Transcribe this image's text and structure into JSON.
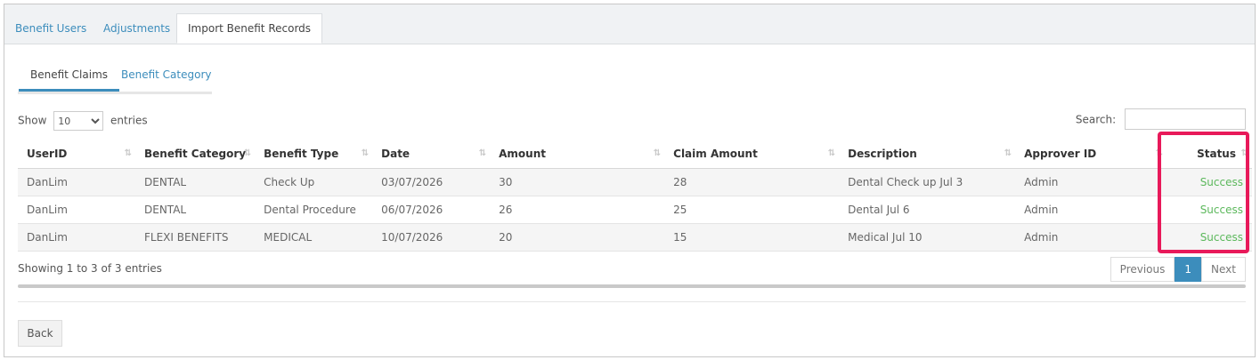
{
  "tabs": [
    {
      "label": "Benefit Users"
    },
    {
      "label": "Adjustments"
    },
    {
      "label": "Import Benefit Records"
    }
  ],
  "subtabs": [
    {
      "label": "Benefit Claims"
    },
    {
      "label": "Benefit Category"
    }
  ],
  "length": {
    "show": "Show",
    "value": "10",
    "entries": "entries"
  },
  "search": {
    "label": "Search:",
    "value": ""
  },
  "table": {
    "headers": [
      "UserID",
      "Benefit Category",
      "Benefit Type",
      "Date",
      "Amount",
      "Claim Amount",
      "Description",
      "Approver ID",
      "Status"
    ],
    "rows": [
      [
        "DanLim",
        "DENTAL",
        "Check Up",
        "03/07/2026",
        "30",
        "28",
        "Dental Check up Jul 3",
        "Admin",
        "Success"
      ],
      [
        "DanLim",
        "DENTAL",
        "Dental Procedure",
        "06/07/2026",
        "26",
        "25",
        "Dental Jul 6",
        "Admin",
        "Success"
      ],
      [
        "DanLim",
        "FLEXI BENEFITS",
        "MEDICAL",
        "10/07/2026",
        "20",
        "15",
        "Medical Jul 10",
        "Admin",
        "Success"
      ]
    ]
  },
  "info": "Showing 1 to 3 of 3 entries",
  "pager": {
    "previous": "Previous",
    "page": "1",
    "next": "Next"
  },
  "back_label": "Back",
  "colors": {
    "accent": "#3c8dbc",
    "success": "#5cb85c",
    "highlight": "#e8195a"
  }
}
